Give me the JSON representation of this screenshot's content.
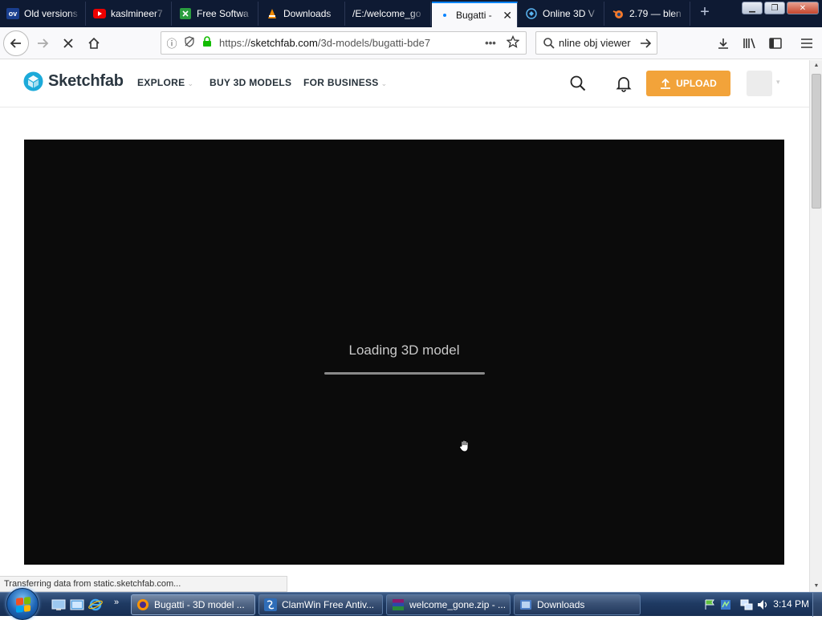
{
  "browser": {
    "tabs": [
      {
        "label": "Old versions",
        "icon": "oldversion-favicon",
        "active": false
      },
      {
        "label": "kaslmineer7",
        "icon": "youtube-favicon",
        "active": false
      },
      {
        "label": "Free Softwa",
        "icon": "softpedia-favicon",
        "active": false
      },
      {
        "label": "Downloads",
        "icon": "vlc-favicon",
        "active": false
      },
      {
        "label": "/E:/welcome_go",
        "icon": "file-favicon",
        "active": false
      },
      {
        "label": "Bugatti -",
        "icon": "loading-dot-icon",
        "active": true
      },
      {
        "label": "Online 3D V",
        "icon": "3dviewer-favicon",
        "active": false
      },
      {
        "label": "2.79 — blen",
        "icon": "blender-favicon",
        "active": false
      }
    ],
    "new_tab_label": "+",
    "tab_favicon_text": "ov",
    "url": {
      "prefix": "https://",
      "host": "sketchfab.com",
      "path": "/3d-models/bugatti-bde7"
    },
    "search_value": "nline obj viewer",
    "status_text": "Transferring data from static.sketchfab.com..."
  },
  "page": {
    "logo_text": "Sketchfab",
    "nav": {
      "explore": "EXPLORE",
      "buy": "BUY 3D MODELS",
      "business": "FOR BUSINESS"
    },
    "upload_label": "UPLOAD",
    "viewer": {
      "loading_text": "Loading 3D model",
      "progress": 1.0
    }
  },
  "taskbar": {
    "items": [
      {
        "label": "Bugatti - 3D model ...",
        "icon": "firefox-icon",
        "active": true
      },
      {
        "label": "ClamWin Free Antiv...",
        "icon": "clamwin-icon",
        "active": false
      },
      {
        "label": "welcome_gone.zip - ...",
        "icon": "winrar-icon",
        "active": false
      },
      {
        "label": "Downloads",
        "icon": "folder-icon",
        "active": false
      }
    ],
    "clock": "3:14 PM"
  },
  "colors": {
    "accent": "#0a84ff",
    "upload": "#f2a33a",
    "viewer_bg": "#0b0b0b",
    "sketchfab_blue": "#1caad9"
  }
}
